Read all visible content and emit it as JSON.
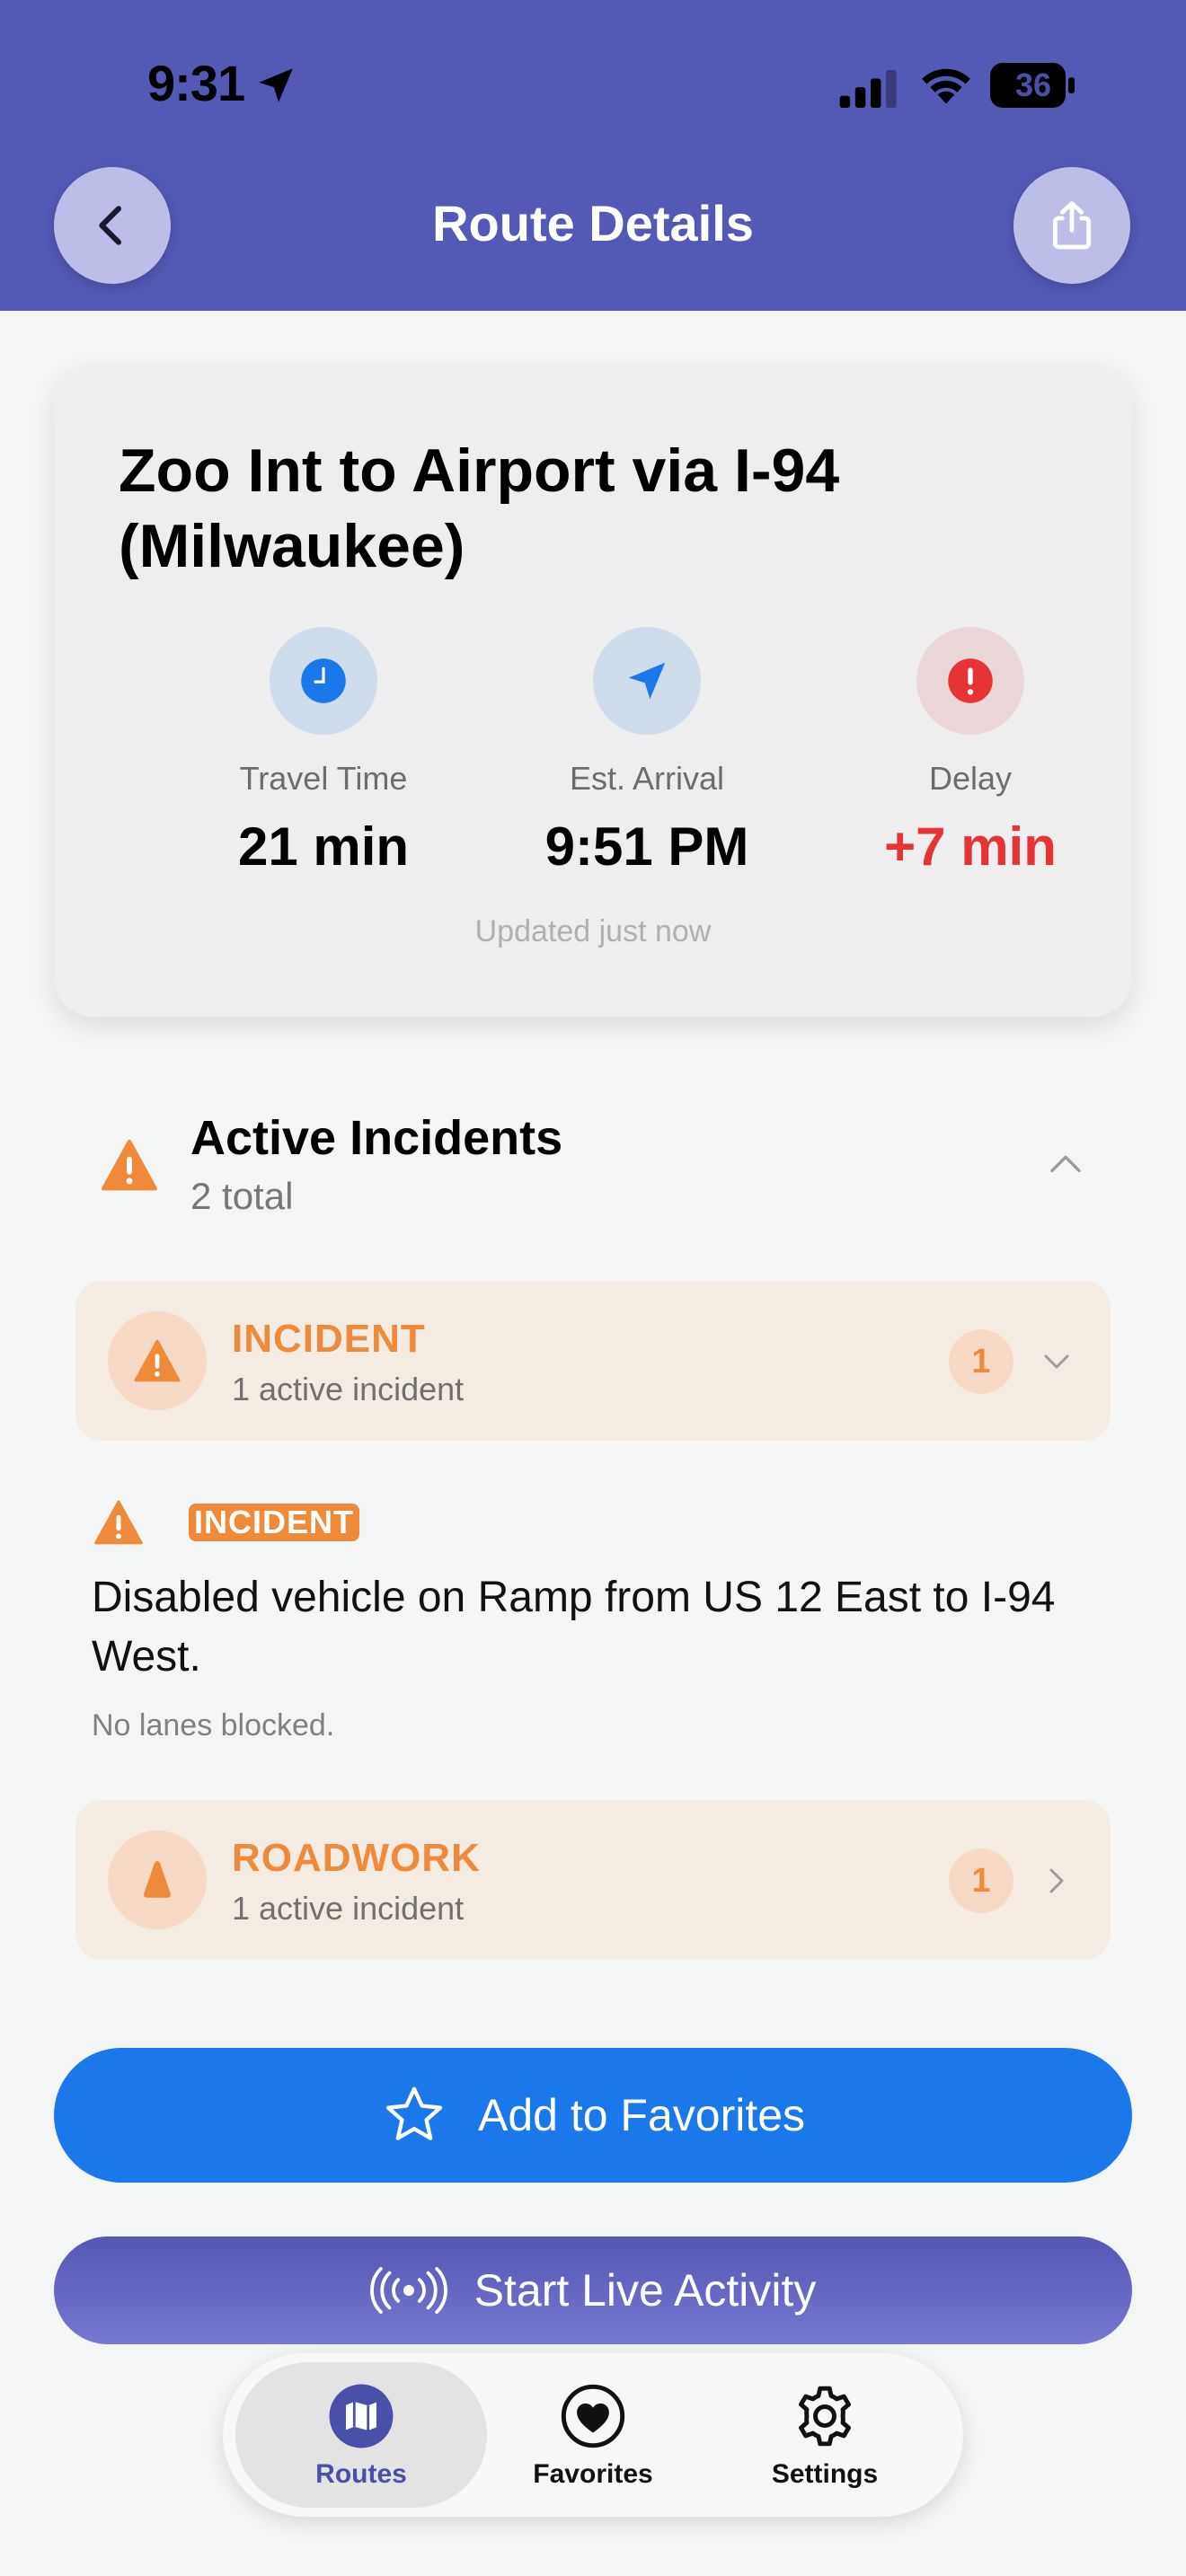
{
  "status_bar": {
    "time": "9:31",
    "battery": "36"
  },
  "header": {
    "title": "Route Details"
  },
  "summary": {
    "route_title": "Zoo Int to Airport via I-94 (Milwaukee)",
    "metrics": [
      {
        "label": "Travel Time",
        "value": "21 min"
      },
      {
        "label": "Est. Arrival",
        "value": "9:51 PM"
      },
      {
        "label": "Delay",
        "value": "+7 min"
      }
    ],
    "updated": "Updated just now"
  },
  "incidents": {
    "title": "Active Incidents",
    "count": "2 total",
    "groups": [
      {
        "title": "INCIDENT",
        "subtitle": "1 active incident",
        "badge": "1",
        "expanded": true
      },
      {
        "title": "ROADWORK",
        "subtitle": "1 active incident",
        "badge": "1",
        "expanded": false
      }
    ],
    "detail": {
      "tag": "INCIDENT",
      "description": "Disabled vehicle on Ramp from US 12 East to I-94 West.",
      "lanes": "No lanes blocked."
    }
  },
  "actions": {
    "favorites": "Add to Favorites",
    "live_activity": "Start Live Activity"
  },
  "tabs": [
    {
      "label": "Routes",
      "icon": "map-icon",
      "selected": true
    },
    {
      "label": "Favorites",
      "icon": "heart-icon",
      "selected": false
    },
    {
      "label": "Settings",
      "icon": "gear-icon",
      "selected": false
    }
  ],
  "colors": {
    "header": "#5459b6",
    "accent_blue": "#1b78ea",
    "delay_red": "#e63434",
    "incident_orange": "#ef8a3a"
  }
}
